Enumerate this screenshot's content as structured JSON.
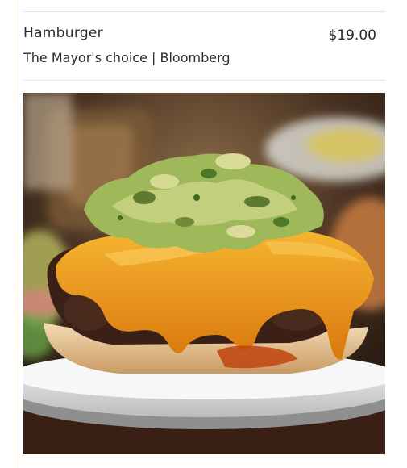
{
  "menu_item": {
    "name": "Hamburger",
    "price": "$19.00",
    "description": "The Mayor's choice | Bloomberg"
  },
  "photo": {
    "subject": "cheeseburger-with-guacamole",
    "alt": "Hamburger"
  },
  "colors": {
    "rule": "#8a7350",
    "divider": "#e2e2e2",
    "text": "#2b2b2b",
    "cheese": "#f0a020",
    "guacamole": "#9fb85a"
  }
}
